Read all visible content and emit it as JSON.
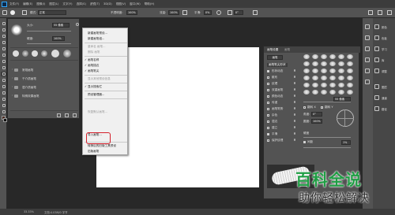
{
  "menubar": {
    "logo": "Ps",
    "items": [
      "文件(F)",
      "编辑(E)",
      "图像(I)",
      "图层(L)",
      "文字(Y)",
      "选择(S)",
      "滤镜(T)",
      "3D(D)",
      "视图(V)",
      "窗口(W)",
      "帮助(H)"
    ]
  },
  "options": {
    "mode_label": "模式:",
    "mode_value": "正常",
    "opacity_label": "不透明度:",
    "opacity_value": "100%",
    "flow_label": "流量:",
    "flow_value": "100%",
    "smooth_label": "平滑:",
    "smooth_value": "0%",
    "angle_value": "0°"
  },
  "brush_panel": {
    "size_label": "大小:",
    "size_value": "55 像素",
    "hardness_label": "硬度:",
    "hardness_value": "100%",
    "folders": [
      "常规画笔",
      "干介质画笔",
      "湿介质画笔",
      "特殊效果画笔"
    ]
  },
  "flyout": {
    "items": [
      {
        "label": "新建画笔预设...",
        "state": "enabled"
      },
      {
        "label": "新建画笔组...",
        "state": "enabled"
      },
      {
        "label": "重命名 画笔...",
        "state": "disabled"
      },
      {
        "label": "删除 画笔",
        "state": "disabled"
      },
      {
        "label": "画笔名称",
        "state": "enabled",
        "checked": true
      },
      {
        "label": "画笔描边",
        "state": "enabled",
        "checked": true
      },
      {
        "label": "画笔笔尖",
        "state": "enabled",
        "checked": true
      },
      {
        "label": "显示其他预设信息",
        "state": "disabled"
      },
      {
        "label": "显示搜索栏",
        "state": "enabled",
        "checked": true
      },
      {
        "label": "预设管理器...",
        "state": "enabled"
      },
      {
        "label": "恢复默认画笔...",
        "state": "disabled"
      },
      {
        "label": "导入画笔...",
        "state": "enabled"
      },
      {
        "label": "导出选中的画笔...",
        "state": "disabled"
      },
      {
        "label": "获取更多画笔...",
        "state": "enabled"
      },
      {
        "label": "转换后的旧版工具预设",
        "state": "enabled"
      },
      {
        "label": "旧版画笔",
        "state": "enabled"
      }
    ]
  },
  "brush_settings": {
    "tab_settings": "画笔设置",
    "tab_brushes": "画笔",
    "brushes_button": "画笔",
    "tip_shape": "画笔笔尖形状",
    "options": [
      {
        "label": "形状动态",
        "on": true
      },
      {
        "label": "散布",
        "on": false
      },
      {
        "label": "纹理",
        "on": false
      },
      {
        "label": "双重画笔",
        "on": false
      },
      {
        "label": "颜色动态",
        "on": false
      },
      {
        "label": "传递",
        "on": false
      },
      {
        "label": "画笔笔势",
        "on": false
      },
      {
        "label": "杂色",
        "on": false
      },
      {
        "label": "湿边",
        "on": false
      },
      {
        "label": "建立",
        "on": false
      },
      {
        "label": "平滑",
        "on": true
      },
      {
        "label": "保护纹理",
        "on": false
      }
    ],
    "flip_x": "翻转 X",
    "flip_y": "翻转 Y",
    "angle_label": "角度:",
    "angle_value": "0°",
    "roundness_label": "圆度:",
    "roundness_value": "100%",
    "hardness_label": "硬度",
    "spacing_label": "间距",
    "spacing_value": "1%",
    "size_value": "55 像素"
  },
  "dock": [
    {
      "label": "颜色"
    },
    {
      "label": "色板"
    },
    {
      "label": "学习"
    },
    {
      "label": "库"
    },
    {
      "label": "调整"
    },
    {
      "label": "图层"
    },
    {
      "label": "通道"
    },
    {
      "label": "路径"
    }
  ],
  "status": {
    "zoom": "33.33%",
    "doc": "文档:4.03M/0 字节"
  },
  "watermark": {
    "title": "百科全说",
    "subtitle": "助你轻松解决"
  }
}
